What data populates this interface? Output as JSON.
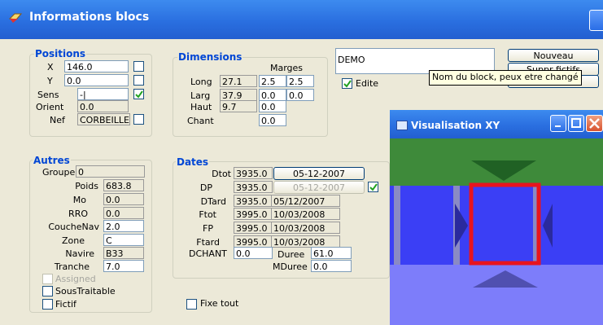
{
  "window": {
    "title": "Informations blocs"
  },
  "positions": {
    "title": "Positions",
    "x_label": "X",
    "x_value": "146.0",
    "y_label": "Y",
    "y_value": "0.0",
    "sens_label": "Sens",
    "sens_value": "-|",
    "orient_label": "Orient",
    "orient_value": "0.0",
    "nef_label": "Nef",
    "nef_value": "CORBEILLE"
  },
  "dimensions": {
    "title": "Dimensions",
    "marges_label": "Marges",
    "long_label": "Long",
    "long_value": "27.1",
    "long_m1": "2.5",
    "long_m2": "2.5",
    "larg_label": "Larg",
    "larg_value": "37.9",
    "larg_m1": "0.0",
    "larg_m2": "0.0",
    "haut_label": "Haut",
    "haut_value": "9.7",
    "haut_m1": "0.0",
    "chant_label": "Chant",
    "chant_m1": "0.0"
  },
  "name_field": {
    "value": "DEMO",
    "tooltip": "Nom du block, peux etre changé"
  },
  "edite": {
    "label": "Edite",
    "checked": true
  },
  "buttons": {
    "nouveau": "Nouveau",
    "suppr": "Suppr fictifs",
    "third_partial": "e"
  },
  "autres": {
    "title": "Autres",
    "groupe_label": "Groupe",
    "groupe_value": "0",
    "poids_label": "Poids",
    "poids_value": "683.8",
    "mo_label": "Mo",
    "mo_value": "0.0",
    "rro_label": "RRO",
    "rro_value": "0.0",
    "couchenav_label": "CoucheNav",
    "couchenav_value": "2.0",
    "zone_label": "Zone",
    "zone_value": "C",
    "navire_label": "Navire",
    "navire_value": "B33",
    "tranche_label": "Tranche",
    "tranche_value": "7.0",
    "assigned_label": "Assigned",
    "soustraitable_label": "SousTraitable",
    "fictif_label": "Fictif"
  },
  "dates": {
    "title": "Dates",
    "dtot_label": "Dtot",
    "dtot_value": "3935.0",
    "dtot_date": "05-12-2007",
    "dp_label": "DP",
    "dp_value": "3935.0",
    "dp_date": "05-12-2007",
    "dtard_label": "DTard",
    "dtard_value": "3935.0",
    "dtard_date": "05/12/2007",
    "ftot_label": "Ftot",
    "ftot_value": "3995.0",
    "ftot_date": "10/03/2008",
    "fp_label": "FP",
    "fp_value": "3995.0",
    "fp_date": "10/03/2008",
    "ftard_label": "Ftard",
    "ftard_value": "3995.0",
    "ftard_date": "10/03/2008",
    "dchant_label": "DCHANT",
    "dchant_value": "0.0",
    "duree_label": "Duree",
    "duree_value": "61.0",
    "mduree_label": "MDuree",
    "mduree_value": "0.0"
  },
  "fixe_tout": {
    "label": "Fixe tout"
  },
  "xy_window": {
    "title": "Visualisation XY"
  },
  "colors": {
    "title_blue": "#2a6fe0",
    "group_title": "#0046d5",
    "canvas_green": "#3e8a3a",
    "canvas_blue": "#3b3ff5",
    "selection_red": "#e8141e"
  }
}
